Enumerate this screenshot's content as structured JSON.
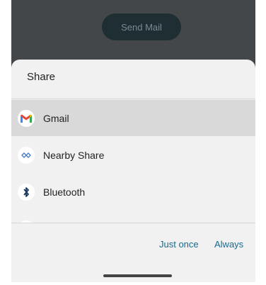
{
  "background": {
    "send_button_label": "Send Mail"
  },
  "share_sheet": {
    "title": "Share",
    "items": [
      {
        "label": "Gmail",
        "icon": "gmail-icon",
        "selected": true
      },
      {
        "label": "Nearby Share",
        "icon": "nearby-share-icon",
        "selected": false
      },
      {
        "label": "Bluetooth",
        "icon": "bluetooth-icon",
        "selected": false
      },
      {
        "label": "",
        "icon": "drive-icon",
        "selected": false
      }
    ],
    "actions": {
      "just_once": "Just once",
      "always": "Always"
    }
  },
  "colors": {
    "accent": "#1b6a8c",
    "scrim": "#434749",
    "sheet": "#f1f1f1",
    "selected_row": "#d9d9d9"
  }
}
